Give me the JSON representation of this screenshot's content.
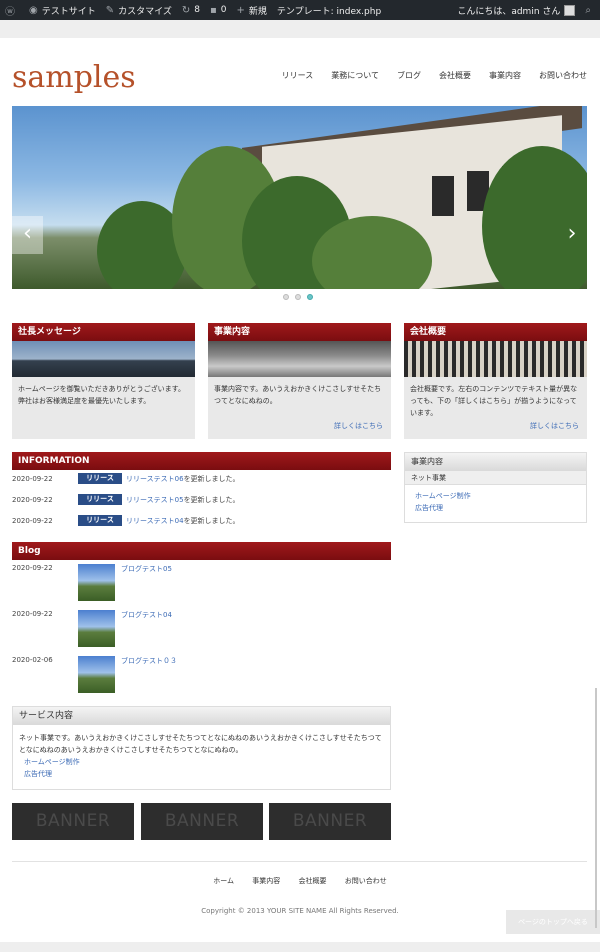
{
  "adminbar": {
    "site": "テストサイト",
    "customize": "カスタマイズ",
    "updates": "8",
    "comments": "0",
    "new": "新規",
    "template": "テンプレート: index.php",
    "greeting": "こんにちは、admin さん"
  },
  "header": {
    "logo": "samples",
    "nav": [
      "リリース",
      "業務について",
      "ブログ",
      "会社概要",
      "事業内容",
      "お問い合わせ"
    ]
  },
  "slider": {
    "prev": "‹",
    "next": "›"
  },
  "boxes": [
    {
      "title": "社長メッセージ",
      "text": "ホームページを御覧いただきありがとうございます。弊社はお客様満足度を最優先いたします。",
      "more": ""
    },
    {
      "title": "事業内容",
      "text": "事業内容です。あいうえおかきくけこさしすせそたちつてとなにぬねの。",
      "more": "詳しくはこちら"
    },
    {
      "title": "会社概要",
      "text": "会社概要です。左右のコンテンツでテキスト量が異なっても、下の「詳しくはこちら」が揃うようになっています。",
      "more": "詳しくはこちら"
    }
  ],
  "information": {
    "title": "INFORMATION",
    "items": [
      {
        "date": "2020-09-22",
        "badge": "リリース",
        "link": "リリーステスト06",
        "suffix": "を更新しました。"
      },
      {
        "date": "2020-09-22",
        "badge": "リリース",
        "link": "リリーステスト05",
        "suffix": "を更新しました。"
      },
      {
        "date": "2020-09-22",
        "badge": "リリース",
        "link": "リリーステスト04",
        "suffix": "を更新しました。"
      }
    ]
  },
  "blog": {
    "title": "Blog",
    "items": [
      {
        "date": "2020-09-22",
        "title": "ブログテスト05"
      },
      {
        "date": "2020-09-22",
        "title": "ブログテスト04"
      },
      {
        "date": "2020-02-06",
        "title": "ブログテスト０３"
      }
    ]
  },
  "service": {
    "title": "サービス内容",
    "text": "ネット事業です。あいうえおかきくけこさしすせそたちつてとなにぬねのあいうえおかきくけこさしすせそたちつてとなにぬねのあいうえおかきくけこさしすせそたちつてとなにぬねの。",
    "links": [
      "ホームページ制作",
      "広告代理"
    ]
  },
  "banners": [
    "BANNER",
    "BANNER",
    "BANNER"
  ],
  "sidebar": {
    "title": "事業内容",
    "sub": "ネット事業",
    "links": [
      "ホームページ制作",
      "広告代理"
    ]
  },
  "footer": {
    "nav": [
      "ホーム",
      "事業内容",
      "会社概要",
      "お問い合わせ"
    ],
    "copyright": "Copyright © 2013 YOUR SITE NAME All Rights Reserved.",
    "totop": "ページのトップへ戻る"
  }
}
